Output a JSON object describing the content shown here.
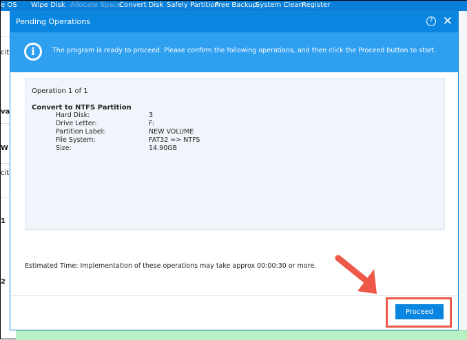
{
  "topnav": {
    "items": [
      "e OS",
      "Wipe Disk",
      "Allocate Space",
      "Convert Disk",
      "Safely Partition",
      "Free Backup",
      "System Clean",
      "Register"
    ]
  },
  "background": {
    "fragments": [
      "city",
      "val",
      "W V",
      "city",
      "1",
      "2"
    ]
  },
  "dialog": {
    "title": "Pending Operations",
    "help_icon": "?",
    "close_icon": "✕",
    "info_message": "The program is ready to proceed. Please confirm the following operations, and then click the Proceed button to start.",
    "operation_counter": "Operation 1 of 1",
    "operation_title": "Convert to NTFS Partition",
    "details": [
      {
        "label": "Hard Disk:",
        "value": "3"
      },
      {
        "label": "Drive Letter:",
        "value": "F:"
      },
      {
        "label": "Partition Label:",
        "value": "NEW VOLUME"
      },
      {
        "label": "File System:",
        "value": "FAT32 => NTFS"
      },
      {
        "label": "Size:",
        "value": "14.90GB"
      }
    ],
    "estimated_time": "Estimated Time: Implementation of these operations may take approx 00:00:30 or more.",
    "proceed_label": "Proceed"
  },
  "colors": {
    "accent": "#0a86e0",
    "info": "#2f9ff0",
    "highlight": "#ee5848"
  }
}
